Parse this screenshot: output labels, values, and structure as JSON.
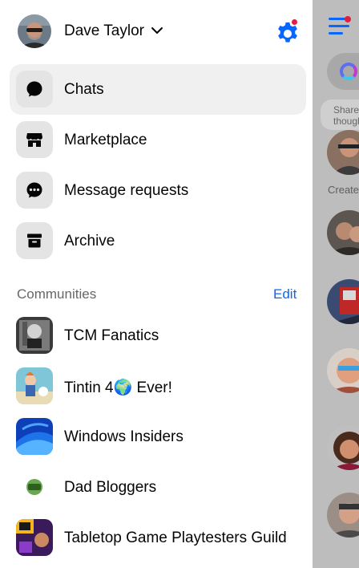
{
  "profile": {
    "name": "Dave Taylor"
  },
  "nav": {
    "items": [
      {
        "label": "Chats",
        "icon": "chat-bubble-icon",
        "active": true
      },
      {
        "label": "Marketplace",
        "icon": "storefront-icon",
        "active": false
      },
      {
        "label": "Message requests",
        "icon": "message-requests-icon",
        "active": false
      },
      {
        "label": "Archive",
        "icon": "archive-box-icon",
        "active": false
      }
    ]
  },
  "communities": {
    "title": "Communities",
    "edit_label": "Edit",
    "items": [
      {
        "label": "TCM Fanatics"
      },
      {
        "label": "Tintin 4🌍 Ever!"
      },
      {
        "label": "Windows Insiders"
      },
      {
        "label": "Dad Bloggers"
      },
      {
        "label": "Tabletop Game Playtesters Guild"
      }
    ]
  },
  "background": {
    "share_text": "Share thought",
    "create_label": "Create"
  },
  "colors": {
    "accent": "#0866ff",
    "badge": "#e41e3f",
    "active_row": "#f0f0f0",
    "secondary_text": "#65676b"
  }
}
